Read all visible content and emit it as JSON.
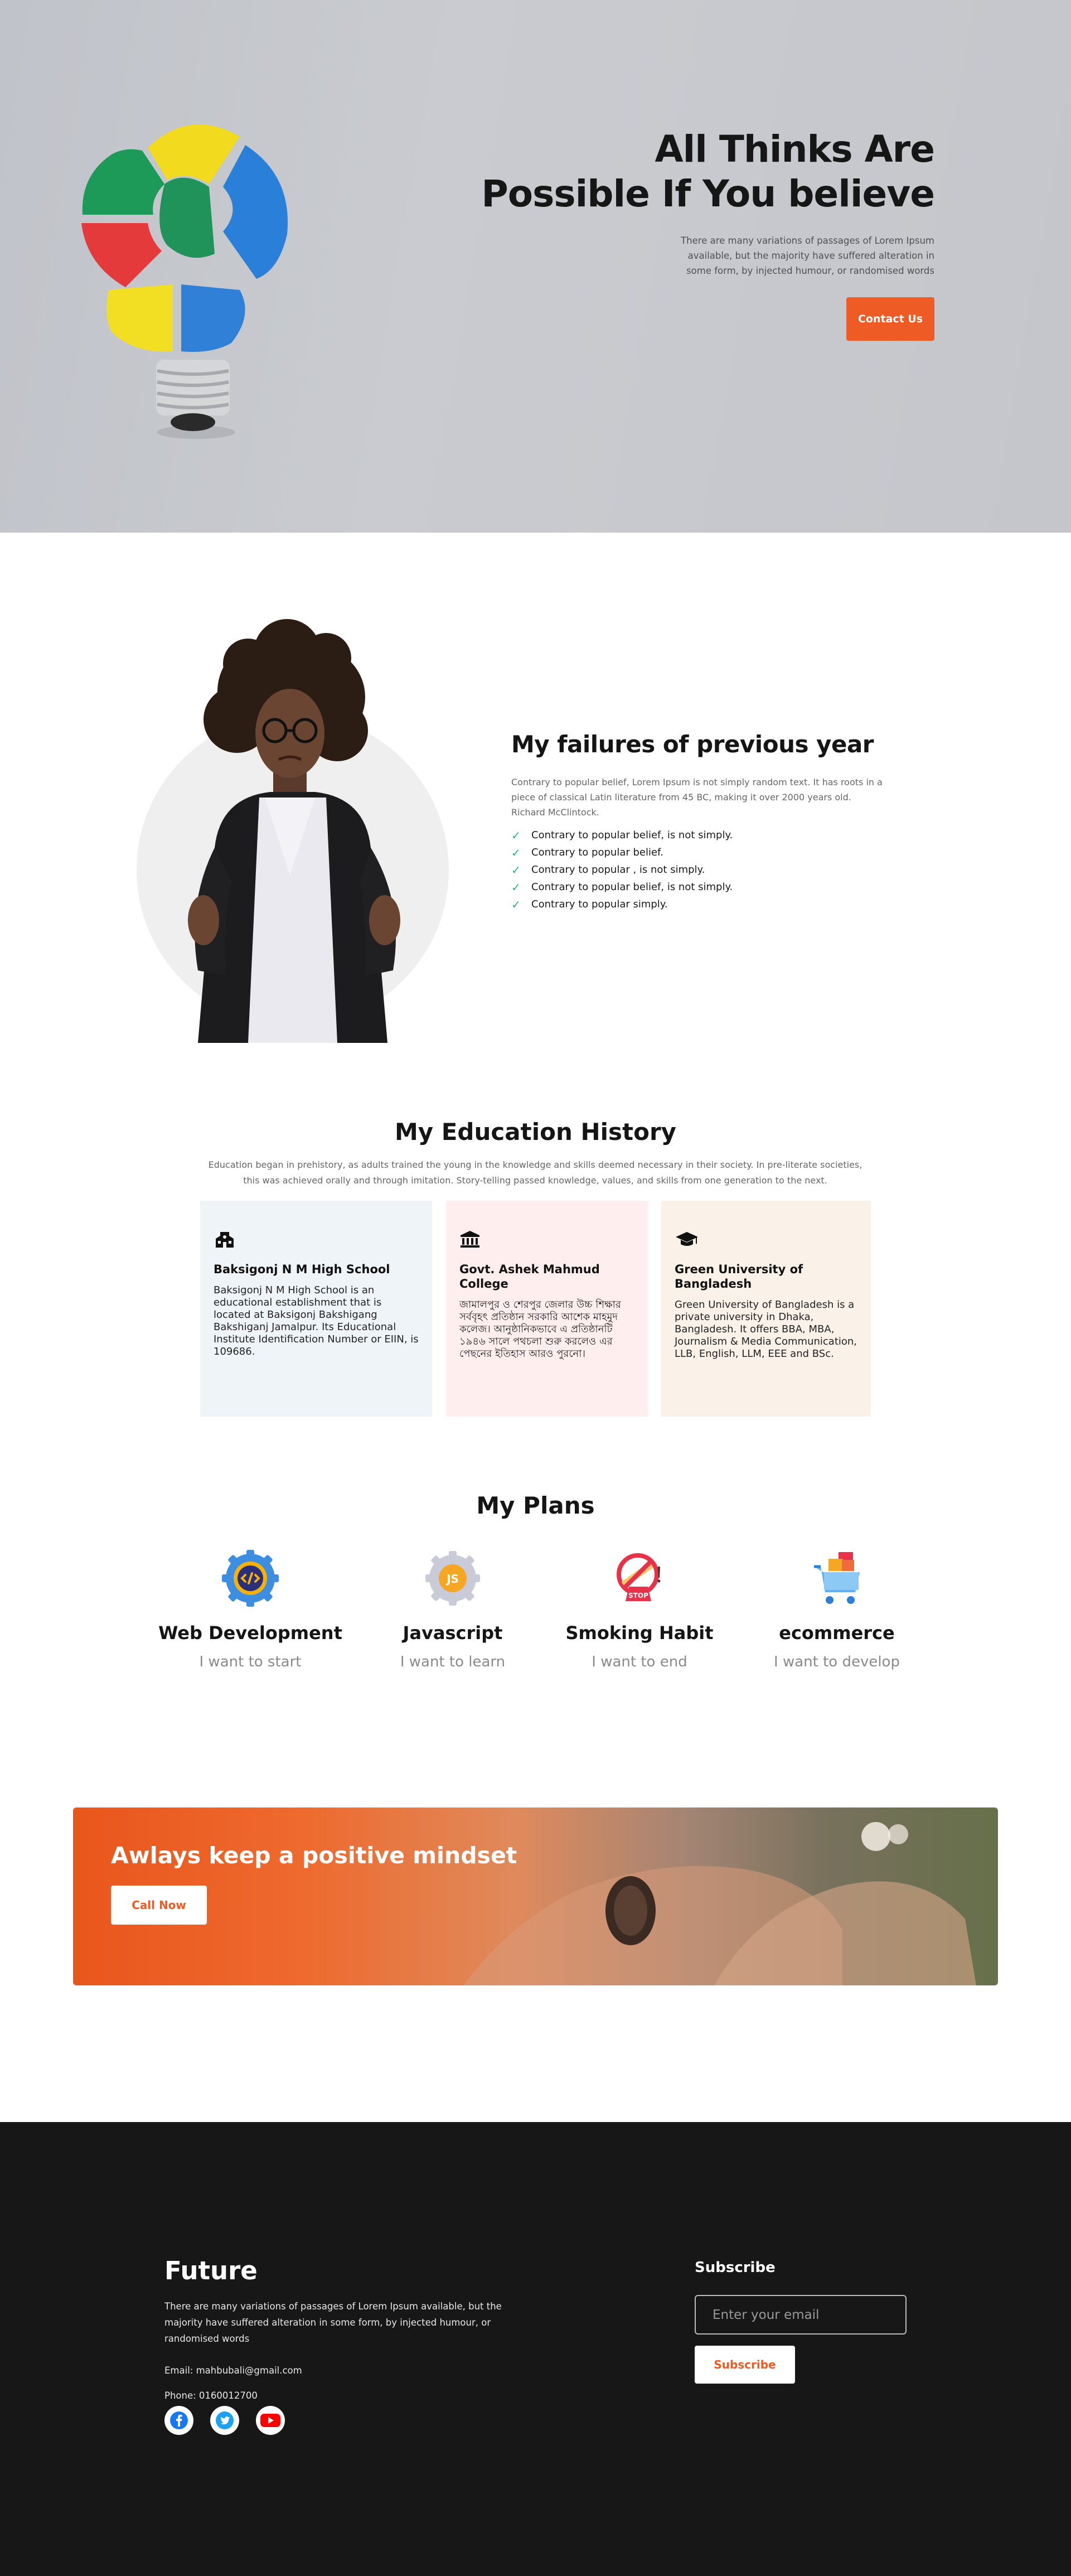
{
  "hero": {
    "title_line1": "All Thinks Are",
    "title_line2": "Possible If You believe",
    "description": "There are many variations of passages of Lorem Ipsum available, but the majority have suffered alteration in some form, by injected humour, or randomised words",
    "cta_label": "Contact Us"
  },
  "failures": {
    "title": "My failures of previous year",
    "description": "Contrary to popular belief, Lorem Ipsum is not simply random text. It has roots in a piece of classical Latin literature from 45 BC, making it over 2000 years old. Richard McClintock.",
    "items": [
      "Contrary to popular belief, is not simply.",
      "Contrary to popular belief.",
      "Contrary to popular , is not simply.",
      "Contrary to popular belief, is not simply.",
      "Contrary to popular simply."
    ]
  },
  "education": {
    "title": "My Education History",
    "description": "Education began in prehistory, as adults trained the young in the knowledge and skills deemed necessary in their society. In pre-literate societies, this was achieved orally and through imitation. Story-telling passed knowledge, values, and skills from one generation to the next.",
    "cards": [
      {
        "icon": "school-icon",
        "name": "Baksigonj N M High School",
        "text": "Baksigonj N M High School is an educational establishment that is located at Baksigonj Bakshigang Bakshiganj Jamalpur. Its Educational Institute Identification Number or EIIN, is 109686.",
        "bg": "#eef4f7"
      },
      {
        "icon": "institution-icon",
        "name": "Govt. Ashek Mahmud College",
        "text": "জামালপুর ও শেরপুর জেলার উচ্চ শিক্ষার সর্ববৃহৎ প্রতিষ্ঠান সরকারি আশেক মাহমুদ কলেজ। আনুষ্ঠানিকভাবে এ প্রতিষ্ঠানটি ১৯৪৬ সালে পথচলা শুরু করলেও এর পেছনের ইতিহাস আরও পুরনো।",
        "bg": "#feeeee"
      },
      {
        "icon": "graduation-cap-icon",
        "name": "Green University of Bangladesh",
        "text": "Green University of Bangladesh is a private university in Dhaka, Bangladesh. It offers BBA, MBA, Journalism & Media Communication, LLB, English, LLM, EEE and BSc.",
        "bg": "#faf1e8"
      }
    ]
  },
  "plans": {
    "title": "My Plans",
    "items": [
      {
        "icon": "code-gear-icon",
        "name": "Web Development",
        "sub": "I want to start"
      },
      {
        "icon": "javascript-gear-icon",
        "name": "Javascript",
        "sub": "I want to learn"
      },
      {
        "icon": "no-smoking-icon",
        "name": "Smoking Habit",
        "sub": "I want to end"
      },
      {
        "icon": "shopping-cart-icon",
        "name": "ecommerce",
        "sub": "I want to develop"
      }
    ]
  },
  "banner": {
    "title": "Awlays keep a positive mindset",
    "cta_label": "Call Now"
  },
  "footer": {
    "brand": "Future",
    "description": "There are many variations of passages of Lorem Ipsum available, but the majority have suffered alteration in some form, by injected humour, or randomised words",
    "email": "Email: mahbubali@gmail.com",
    "phone": "Phone: 0160012700",
    "subscribe_title": "Subscribe",
    "email_placeholder": "Enter your email",
    "subscribe_label": "Subscribe"
  },
  "colors": {
    "accent": "#ef5b24",
    "check": "#28b487",
    "footer_bg": "#171717"
  }
}
